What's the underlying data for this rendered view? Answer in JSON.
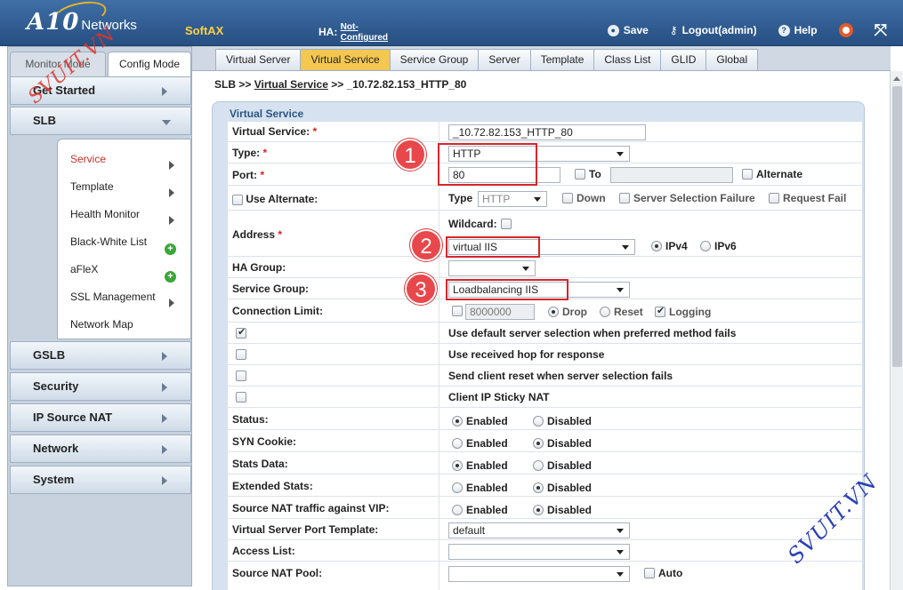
{
  "header": {
    "logo_brand": "A10",
    "logo_text": "Networks",
    "product": "SoftAX",
    "ha_label": "HA:",
    "ha_value_line1": "Not-",
    "ha_value_line2": "Configured",
    "save": "Save",
    "logout": "Logout(admin)",
    "help": "Help"
  },
  "mode_tabs": {
    "monitor": "Monitor Mode",
    "config": "Config Mode"
  },
  "sidebar": {
    "get_started": "Get Started",
    "slb": "SLB",
    "slb_sub": [
      "Service",
      "Template",
      "Health Monitor",
      "Black-White List",
      "aFleX",
      "SSL Management",
      "Network Map"
    ],
    "gslb": "GSLB",
    "security": "Security",
    "ip_source_nat": "IP Source NAT",
    "network": "Network",
    "system": "System"
  },
  "content_tabs": [
    "Virtual Server",
    "Virtual Service",
    "Service Group",
    "Server",
    "Template",
    "Class List",
    "GLID",
    "Global"
  ],
  "active_tab": "Virtual Service",
  "breadcrumb": {
    "root": "SLB",
    "sep": ">>",
    "link": "Virtual Service",
    "current": "_10.72.82.153_HTTP_80"
  },
  "panel_title": "Virtual Service",
  "form": {
    "virtual_service_label": "Virtual Service:",
    "virtual_service_value": "_10.72.82.153_HTTP_80",
    "type_label": "Type:",
    "type_value": "HTTP",
    "port_label": "Port:",
    "port_value": "80",
    "to_label": "To",
    "alternate_label": "Alternate",
    "use_alternate_label": "Use Alternate:",
    "alt_type_label": "Type",
    "alt_type_value": "HTTP",
    "down_label": "Down",
    "ssf_label": "Server Selection Failure",
    "request_fail_label": "Request Fail",
    "address_label": "Address",
    "wildcard_label": "Wildcard:",
    "address_value": "virtual IIS",
    "ipv4_label": "IPv4",
    "ipv6_label": "IPv6",
    "ha_group_label": "HA Group:",
    "service_group_label": "Service Group:",
    "service_group_value": "Loadbalancing IIS",
    "conn_limit_label": "Connection Limit:",
    "conn_limit_value": "8000000",
    "drop_label": "Drop",
    "reset_label": "Reset",
    "logging_label": "Logging",
    "opt1": "Use default server selection when preferred method fails",
    "opt2": "Use received hop for response",
    "opt3": "Send client reset when server selection fails",
    "opt4": "Client IP Sticky NAT",
    "status_label": "Status:",
    "syn_cookie_label": "SYN Cookie:",
    "stats_data_label": "Stats Data:",
    "extended_stats_label": "Extended Stats:",
    "source_nat_vip_label": "Source NAT traffic against VIP:",
    "enabled": "Enabled",
    "disabled": "Disabled",
    "vs_port_template_label": "Virtual Server Port Template:",
    "vs_port_template_value": "default",
    "access_list_label": "Access List:",
    "source_nat_pool_label": "Source NAT Pool:",
    "auto_label": "Auto"
  },
  "annotations": [
    "1",
    "2",
    "3"
  ],
  "watermark": "SVUIT.VN",
  "colors": {
    "header_blue": "#274f82",
    "active_tab": "#f3c750",
    "highlight_red": "#d6262b",
    "active_menu": "#c8332a"
  }
}
